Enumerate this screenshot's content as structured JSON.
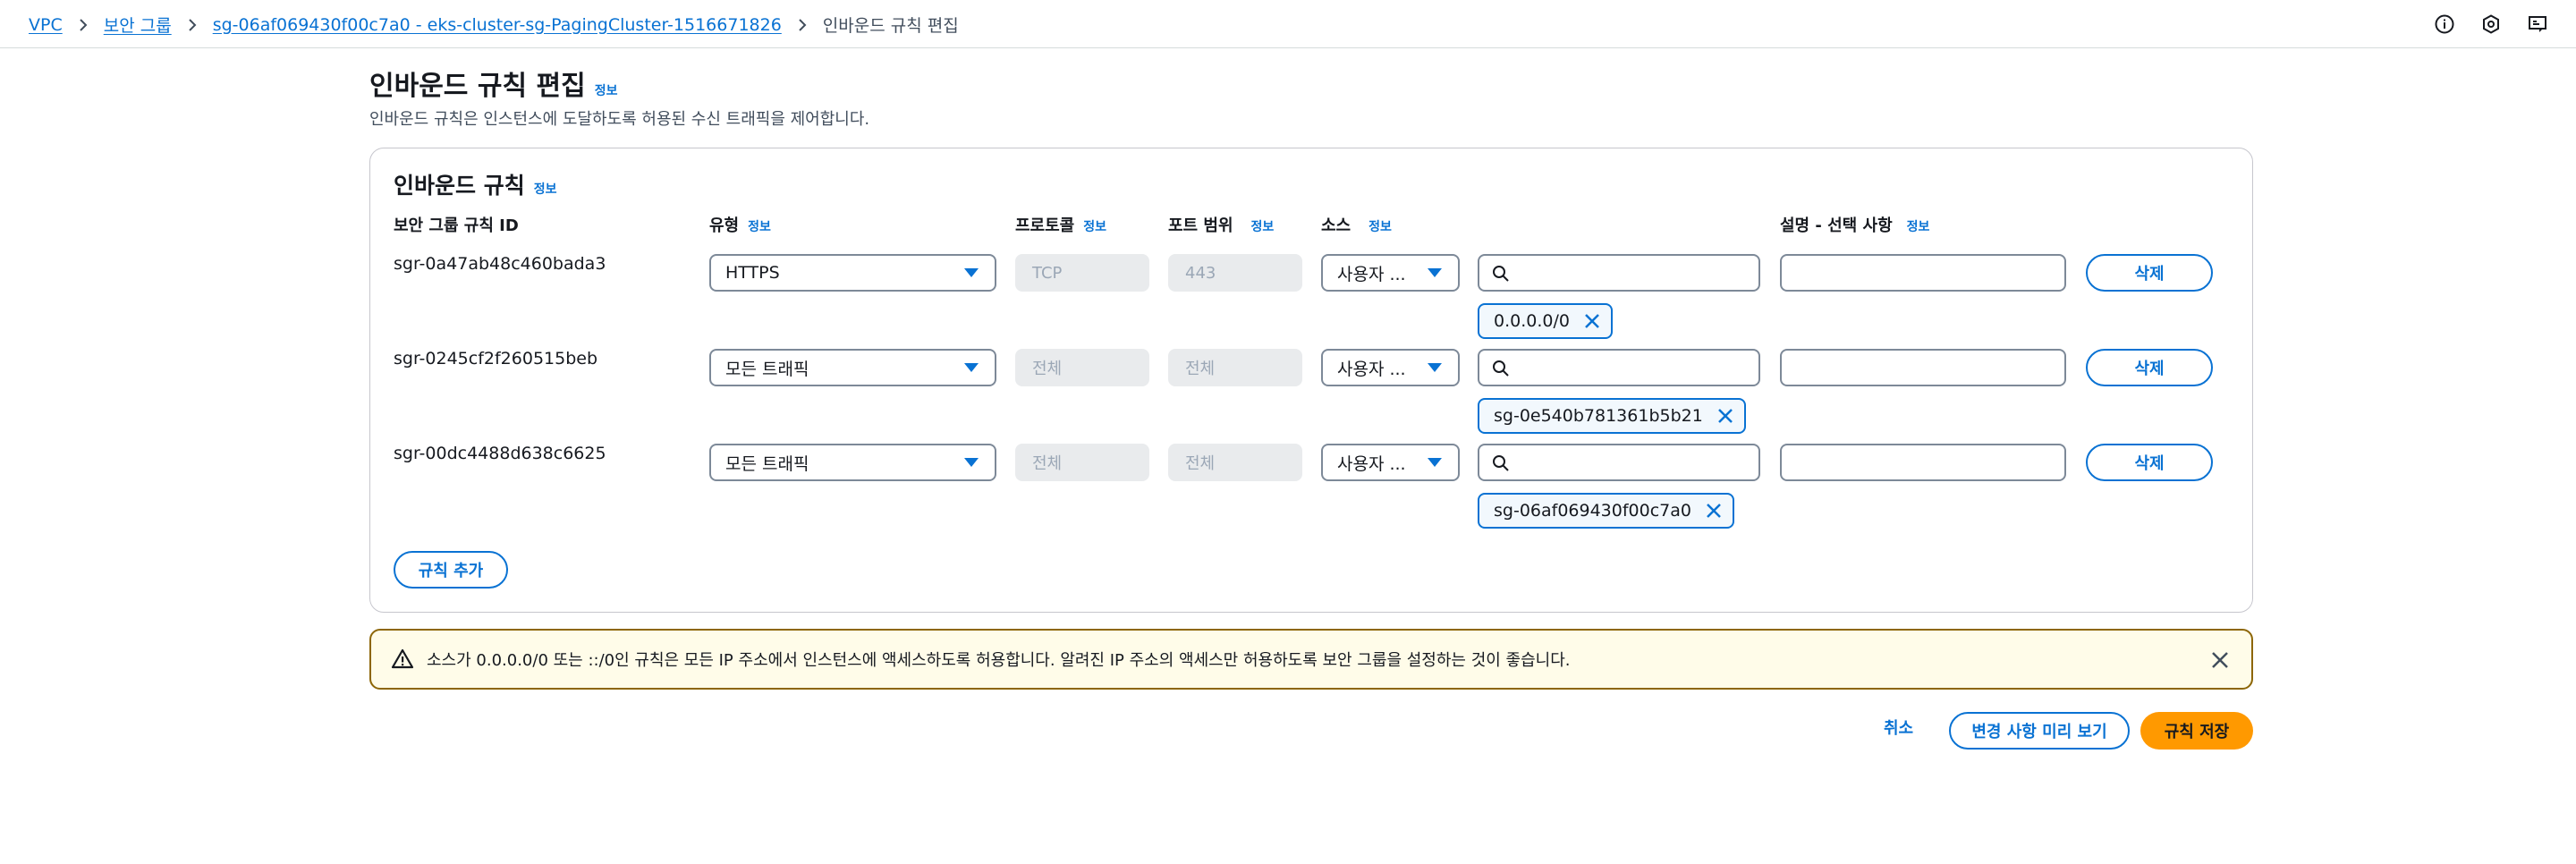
{
  "breadcrumb": {
    "items": [
      "VPC",
      "보안 그룹",
      "sg-06af069430f00c7a0 - eks-cluster-sg-PagingCluster-1516671826"
    ],
    "current": "인바운드 규칙 편집"
  },
  "header": {
    "icons": [
      "info-circle-icon",
      "shield-settings-icon",
      "feedback-icon"
    ]
  },
  "page": {
    "title": "인바운드 규칙 편집",
    "info": "정보",
    "description": "인바운드 규칙은 인스턴스에 도달하도록 허용된 수신 트래픽을 제어합니다."
  },
  "rules_panel": {
    "title": "인바운드 규칙",
    "info": "정보",
    "columns": {
      "rule_id": "보안 그룹 규칙 ID",
      "type": "유형",
      "protocol": "프로토콜",
      "port_range": "포트 범위",
      "source": "소스",
      "description": "설명 - 선택 사항"
    },
    "rows": [
      {
        "id": "sgr-0a47ab48c460bada3",
        "type": "HTTPS",
        "protocol": "TCP",
        "port": "443",
        "source_type": "사용자 ...",
        "token": "0.0.0.0/0",
        "delete": "삭제"
      },
      {
        "id": "sgr-0245cf2f260515beb",
        "type": "모든 트래픽",
        "protocol": "전체",
        "port": "전체",
        "source_type": "사용자 ...",
        "token": "sg-0e540b781361b5b21",
        "delete": "삭제"
      },
      {
        "id": "sgr-00dc4488d638c6625",
        "type": "모든 트래픽",
        "protocol": "전체",
        "port": "전체",
        "source_type": "사용자 ...",
        "token": "sg-06af069430f00c7a0",
        "delete": "삭제"
      }
    ],
    "add_rule": "규칙 추가"
  },
  "warning": {
    "text": "소스가 0.0.0.0/0 또는 ::/0인 규칙은 모든 IP 주소에서 인스턴스에 액세스하도록 허용합니다. 알려진 IP 주소의 액세스만 허용하도록 보안 그룹을 설정하는 것이 좋습니다."
  },
  "footer": {
    "cancel": "취소",
    "preview": "변경 사항 미리 보기",
    "save": "규칙 저장"
  },
  "colors": {
    "link": "#0972d3",
    "primary": "#ff9900",
    "warning_border": "#8d6605"
  }
}
